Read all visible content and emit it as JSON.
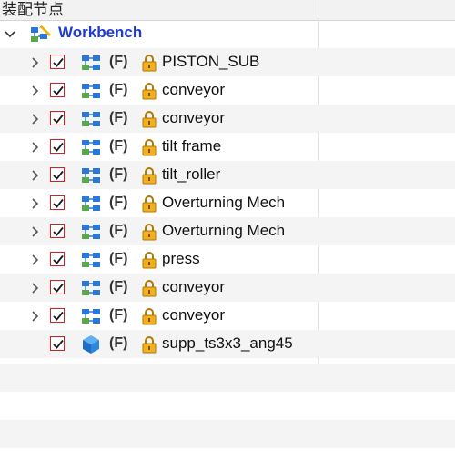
{
  "header": {
    "title": "装配节点"
  },
  "tree": {
    "root": {
      "label": "Workbench",
      "icon": "assembly-pencil-icon"
    },
    "children": [
      {
        "flag": "(F)",
        "label": "PISTON_SUB",
        "checked": true,
        "type": "assembly"
      },
      {
        "flag": "(F)",
        "label": "conveyor",
        "checked": true,
        "type": "assembly"
      },
      {
        "flag": "(F)",
        "label": "conveyor",
        "checked": true,
        "type": "assembly"
      },
      {
        "flag": "(F)",
        "label": "tilt frame",
        "checked": true,
        "type": "assembly"
      },
      {
        "flag": "(F)",
        "label": "tilt_roller",
        "checked": true,
        "type": "assembly"
      },
      {
        "flag": "(F)",
        "label": "Overturning Mech",
        "checked": true,
        "type": "assembly"
      },
      {
        "flag": "(F)",
        "label": "Overturning Mech",
        "checked": true,
        "type": "assembly"
      },
      {
        "flag": "(F)",
        "label": "press",
        "checked": true,
        "type": "assembly"
      },
      {
        "flag": "(F)",
        "label": "conveyor",
        "checked": true,
        "type": "assembly"
      },
      {
        "flag": "(F)",
        "label": "conveyor",
        "checked": true,
        "type": "assembly"
      },
      {
        "flag": "(F)",
        "label": "supp_ts3x3_ang45",
        "checked": true,
        "type": "part"
      }
    ]
  },
  "colors": {
    "root_label": "#1f3bd6",
    "checkbox_border": "#d21f1f",
    "lock": "#e6a000",
    "stripe": "#f4f4f4"
  }
}
